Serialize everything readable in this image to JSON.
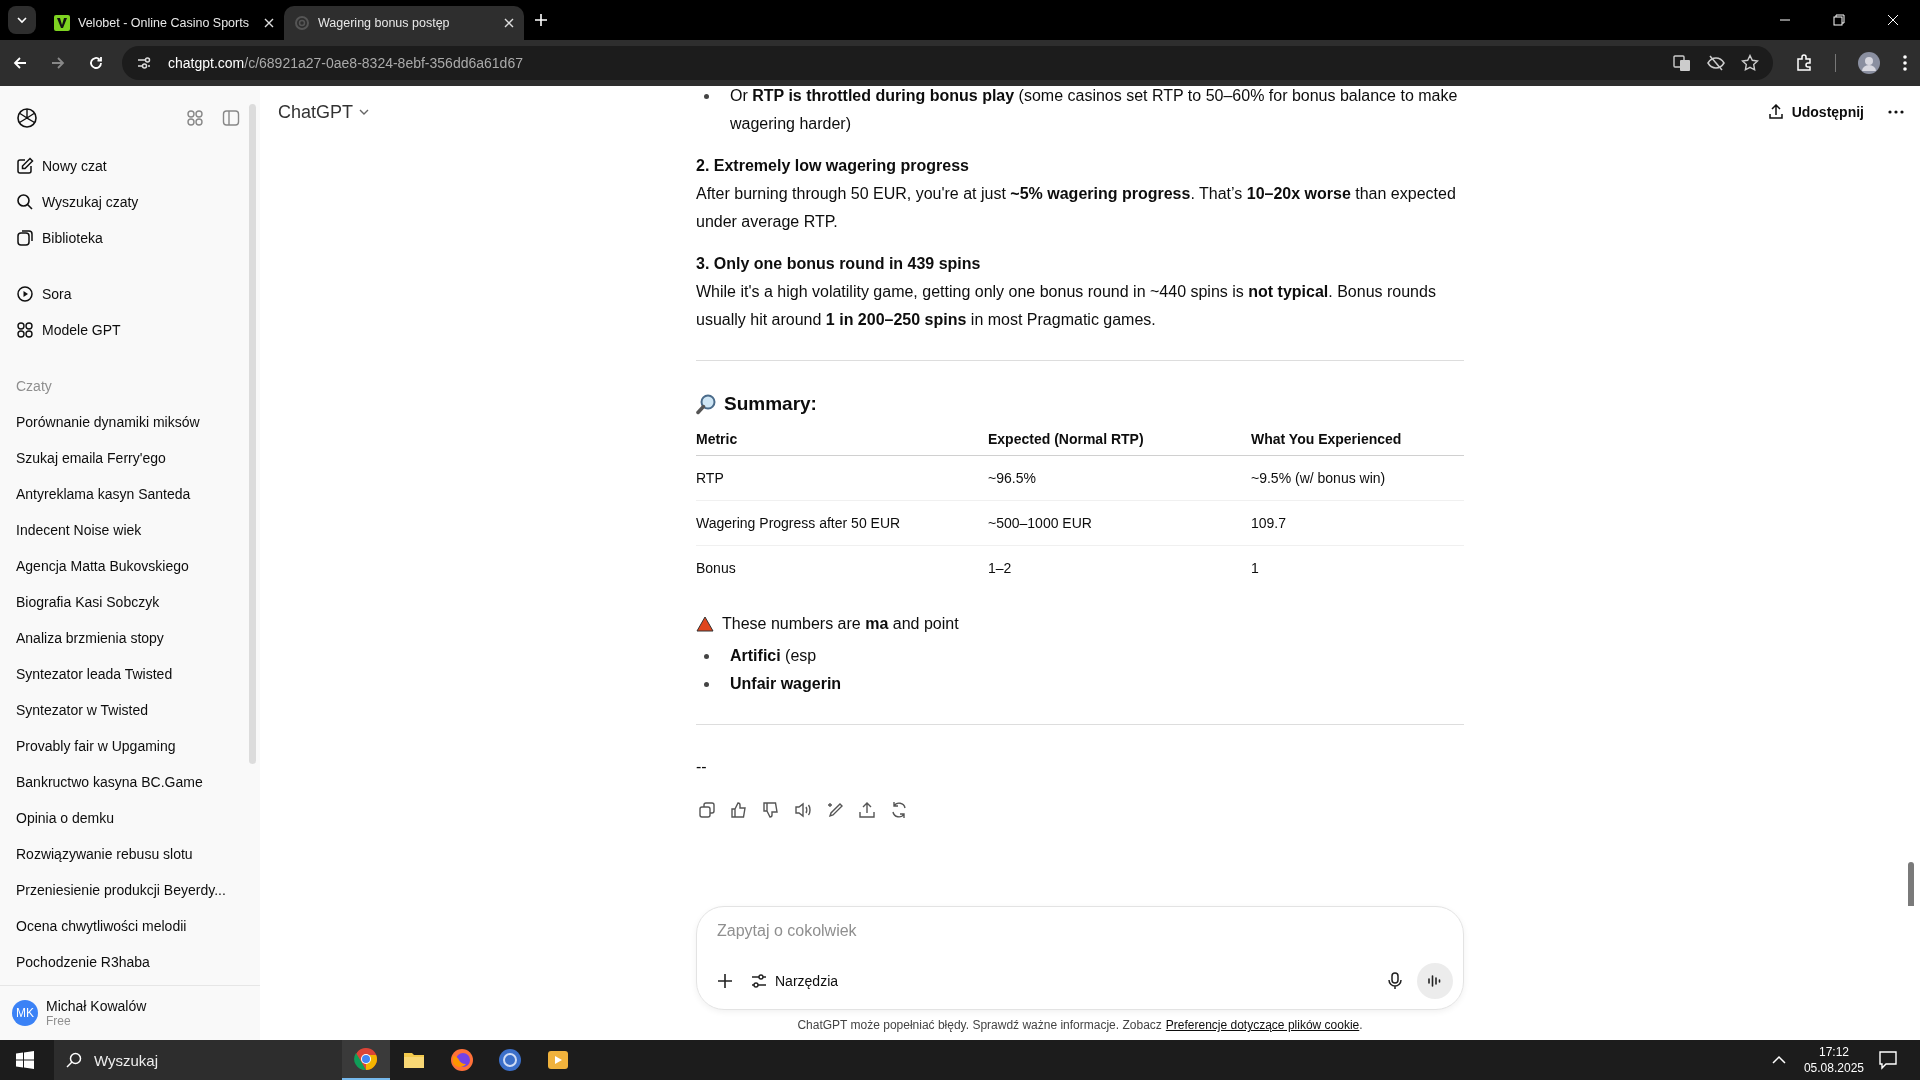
{
  "browser": {
    "tabs": [
      {
        "title": "Velobet - Online Casino Sports",
        "selected": false
      },
      {
        "title": "Wagering bonus postęp",
        "selected": true
      }
    ],
    "url": {
      "host": "chatgpt.com",
      "path": "/c/68921a27-0ae8-8324-8ebf-356dd6a61d67"
    }
  },
  "sidebar": {
    "nav": [
      {
        "label": "Nowy czat"
      },
      {
        "label": "Wyszukaj czaty"
      },
      {
        "label": "Biblioteka"
      }
    ],
    "tools": [
      {
        "label": "Sora"
      },
      {
        "label": "Modele GPT"
      }
    ],
    "section_label": "Czaty",
    "chats": [
      "Porównanie dynamiki miksów",
      "Szukaj emaila Ferry'ego",
      "Antyreklama kasyn Santeda",
      "Indecent Noise wiek",
      "Agencja Matta Bukovskiego",
      "Biografia Kasi Sobczyk",
      "Analiza brzmienia stopy",
      "Syntezator leada Twisted",
      "Syntezator w Twisted",
      "Provably fair w Upgaming",
      "Bankructwo kasyna BC.Game",
      "Opinia o demku",
      "Rozwiązywanie rebusu slotu",
      "Przeniesienie produkcji Beyerdy...",
      "Ocena chwytliwości melodii",
      "Pochodzenie R3haba"
    ],
    "user": {
      "initials": "MK",
      "name": "Michał Kowalów",
      "plan": "Free"
    }
  },
  "header": {
    "title": "ChatGPT",
    "share": "Udostępnij"
  },
  "message": {
    "blocks": [
      {
        "kind": "bullet",
        "text": "Or **RTP is throttled during bonus play** (some casinos set RTP to 50–60% for bonus balance to make wagering harder)"
      },
      {
        "kind": "heading",
        "text": "2. Extremely low wagering progress"
      },
      {
        "kind": "paragraph",
        "text": "After burning through 50 EUR, you're at just **~5% wagering progress**. That’s **10–20x worse** than expected under average RTP."
      },
      {
        "kind": "heading",
        "text": "3. Only one bonus round in 439 spins"
      },
      {
        "kind": "paragraph",
        "text": "While it's a high volatility game, getting only one bonus round in ~440 spins is **not typical**. Bonus rounds usually hit around **1 in 200–250 spins** in most Pragmatic games."
      },
      {
        "kind": "rule"
      },
      {
        "kind": "section",
        "text": "Summary:"
      },
      {
        "kind": "table",
        "columns": [
          "Metric",
          "Expected (Normal RTP)",
          "What You Experienced"
        ],
        "rows": [
          [
            "RTP",
            "~96.5%",
            "~9.5% (w/ bonus win)"
          ],
          [
            "Wagering Progress after 50 EUR",
            "~500–1000 EUR",
            "109.7"
          ],
          [
            "Bonus",
            "1–2",
            "1"
          ]
        ]
      },
      {
        "kind": "callout",
        "text": "These numbers are **ma** and point"
      },
      {
        "kind": "bullet",
        "text": "**Artifici** (esp"
      },
      {
        "kind": "bullet",
        "text": "**Unfair wagerin**"
      },
      {
        "kind": "rule"
      },
      {
        "kind": "paragraph",
        "text": "--"
      }
    ]
  },
  "composer": {
    "placeholder": "Zapytaj o cokolwiek",
    "tools": "Narzędzia"
  },
  "footer": {
    "text": "ChatGPT może popełniać błędy. Sprawdź ważne informacje. Zobacz",
    "link": "Preferencje dotyczące plików cookie",
    "end": "."
  },
  "taskbar": {
    "search": "Wyszukaj",
    "apps": [
      {
        "selected": true
      },
      {
        "selected": false
      },
      {
        "selected": false
      },
      {
        "selected": false
      },
      {
        "selected": false
      }
    ],
    "time": "17:12",
    "date": "05.08.2025"
  }
}
